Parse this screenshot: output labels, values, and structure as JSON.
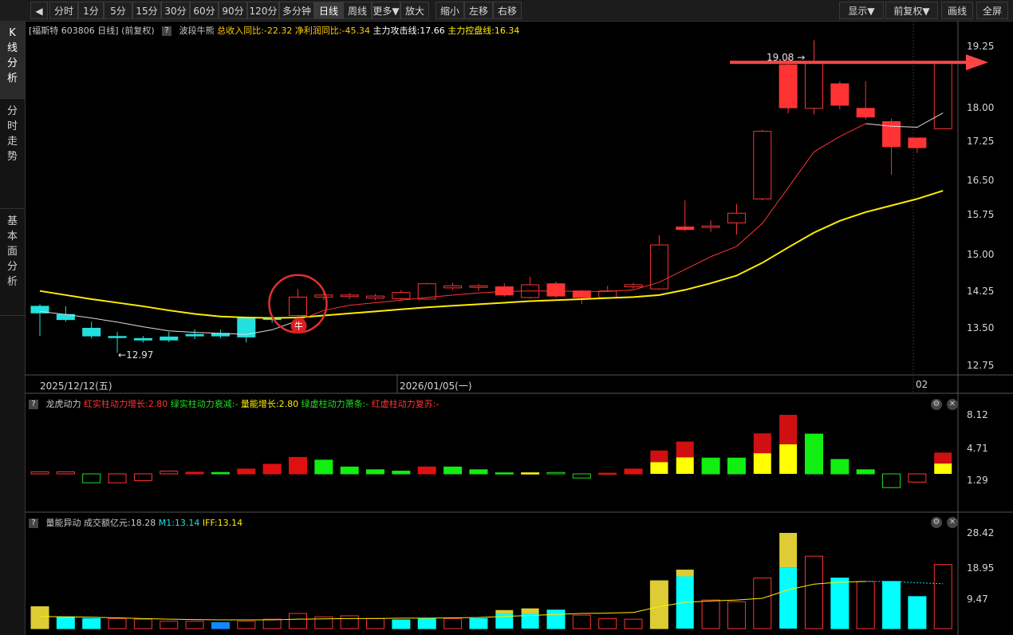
{
  "toolbar": {
    "tabs": [
      "分时",
      "1分",
      "5分",
      "15分",
      "30分",
      "60分",
      "90分",
      "120分",
      "多分钟",
      "日线",
      "周线",
      "更多▼",
      "放大",
      "缩小",
      "左移",
      "右移"
    ],
    "active": "日线",
    "right": [
      "显示▼",
      "前复权▼",
      "画线",
      "全屏"
    ]
  },
  "side_tabs": [
    {
      "label": "K线分析",
      "active": true
    },
    {
      "label": "分时走势",
      "active": false
    },
    {
      "label": "基本面分析",
      "active": false
    }
  ],
  "header": {
    "stock": "[福斯特 603806 日线]",
    "adjust": "(前复权)",
    "help": "?",
    "indicator": "波段牛熊",
    "rev": "总收入同比:-22.32",
    "profit": "净利润同比:-45.34",
    "attack": "主力攻击线:17.66",
    "control": "主力控盘线:16.34"
  },
  "price_axis": [
    "19.25",
    "18.00",
    "17.25",
    "16.50",
    "15.75",
    "15.00",
    "14.25",
    "13.50",
    "12.75"
  ],
  "date_labels": [
    "2025/12/12(五)",
    "2026/01/05(一)",
    "02"
  ],
  "annotations": {
    "high": "19.08",
    "low": "12.97",
    "bull_marker": "牛"
  },
  "panel2": {
    "help": "?",
    "name": "龙虎动力",
    "l1": "红实柱动力增长:2.80",
    "l2": "绿实柱动力衰减:-",
    "l3": "量能增长:2.80",
    "l4": "绿虚柱动力萧条:-",
    "l5": "红虚柱动力复苏:-",
    "axis": [
      "8.12",
      "4.71",
      "1.29"
    ]
  },
  "panel3": {
    "help": "?",
    "name": "量能异动",
    "l1": "成交额亿元:18.28",
    "l2": "M1:13.14",
    "l3": "IFF:13.14",
    "axis": [
      "28.42",
      "18.95",
      "9.47"
    ]
  },
  "colors": {
    "up": "#ff3333",
    "down": "#22e0e0",
    "ma_yellow": "#ffee00",
    "ma_red": "#ff3333",
    "ma_white": "#dddddd",
    "arrow": "#ff4444"
  },
  "chart_data": {
    "type": "candlestick",
    "ylim": [
      12.6,
      19.4
    ],
    "candles": [
      {
        "o": 13.88,
        "c": 13.75,
        "h": 13.92,
        "l": 13.3,
        "up": false
      },
      {
        "o": 13.72,
        "c": 13.62,
        "h": 13.88,
        "l": 13.58,
        "up": false
      },
      {
        "o": 13.45,
        "c": 13.3,
        "h": 13.58,
        "l": 13.25,
        "up": false
      },
      {
        "o": 13.29,
        "c": 13.27,
        "h": 13.38,
        "l": 12.97,
        "up": false
      },
      {
        "o": 13.25,
        "c": 13.22,
        "h": 13.3,
        "l": 13.17,
        "up": false
      },
      {
        "o": 13.28,
        "c": 13.22,
        "h": 13.38,
        "l": 13.18,
        "up": false
      },
      {
        "o": 13.33,
        "c": 13.3,
        "h": 13.43,
        "l": 13.24,
        "up": false
      },
      {
        "o": 13.35,
        "c": 13.3,
        "h": 13.42,
        "l": 13.25,
        "up": false
      },
      {
        "o": 13.65,
        "c": 13.28,
        "h": 13.67,
        "l": 13.17,
        "up": false
      },
      {
        "o": 13.65,
        "c": 13.62,
        "h": 13.7,
        "l": 13.56,
        "up": false
      },
      {
        "o": 13.7,
        "c": 14.06,
        "h": 14.22,
        "l": 13.65,
        "up": true
      },
      {
        "o": 14.06,
        "c": 14.1,
        "h": 14.18,
        "l": 14.0,
        "up": true
      },
      {
        "o": 14.07,
        "c": 14.1,
        "h": 14.14,
        "l": 14.02,
        "up": true
      },
      {
        "o": 14.04,
        "c": 14.08,
        "h": 14.12,
        "l": 14.0,
        "up": true
      },
      {
        "o": 14.03,
        "c": 14.15,
        "h": 14.2,
        "l": 14.0,
        "up": true
      },
      {
        "o": 14.02,
        "c": 14.32,
        "h": 14.34,
        "l": 14.01,
        "up": true
      },
      {
        "o": 14.24,
        "c": 14.28,
        "h": 14.34,
        "l": 14.2,
        "up": true
      },
      {
        "o": 14.25,
        "c": 14.28,
        "h": 14.32,
        "l": 14.18,
        "up": true
      },
      {
        "o": 14.26,
        "c": 14.1,
        "h": 14.33,
        "l": 14.07,
        "up": true
      },
      {
        "o": 14.05,
        "c": 14.3,
        "h": 14.46,
        "l": 14.03,
        "up": true
      },
      {
        "o": 14.32,
        "c": 14.08,
        "h": 14.36,
        "l": 14.04,
        "up": true
      },
      {
        "o": 14.18,
        "c": 14.05,
        "h": 14.2,
        "l": 13.92,
        "up": true
      },
      {
        "o": 14.05,
        "c": 14.18,
        "h": 14.28,
        "l": 14.03,
        "up": true
      },
      {
        "o": 14.26,
        "c": 14.3,
        "h": 14.34,
        "l": 14.22,
        "up": true
      },
      {
        "o": 14.22,
        "c": 15.08,
        "h": 15.27,
        "l": 14.2,
        "up": true
      },
      {
        "o": 15.43,
        "c": 15.38,
        "h": 15.95,
        "l": 15.35,
        "up": true
      },
      {
        "o": 15.42,
        "c": 15.45,
        "h": 15.56,
        "l": 15.33,
        "up": true
      },
      {
        "o": 15.51,
        "c": 15.7,
        "h": 15.88,
        "l": 15.28,
        "up": true
      },
      {
        "o": 15.98,
        "c": 17.3,
        "h": 17.33,
        "l": 15.95,
        "up": true
      },
      {
        "o": 18.6,
        "c": 17.76,
        "h": 18.76,
        "l": 17.65,
        "up": true
      },
      {
        "o": 17.75,
        "c": 18.66,
        "h": 19.08,
        "l": 17.63,
        "up": true
      },
      {
        "o": 18.23,
        "c": 17.81,
        "h": 18.28,
        "l": 17.73,
        "up": true
      },
      {
        "o": 17.75,
        "c": 17.58,
        "h": 18.28,
        "l": 17.53,
        "up": true
      },
      {
        "o": 17.49,
        "c": 17.0,
        "h": 17.55,
        "l": 16.45,
        "up": true
      },
      {
        "o": 17.17,
        "c": 16.98,
        "h": 17.17,
        "l": 16.88,
        "up": true
      },
      {
        "o": 17.35,
        "c": 18.63,
        "h": 18.63,
        "l": 17.35,
        "up": true
      }
    ],
    "ma_white": [
      13.78,
      13.72,
      13.65,
      13.57,
      13.48,
      13.4,
      13.37,
      13.35,
      13.33,
      13.42,
      13.6,
      13.8,
      13.9,
      13.95,
      14.0,
      14.05,
      14.1,
      14.14,
      14.17,
      14.18,
      14.18,
      14.17,
      14.17,
      14.2,
      14.35,
      14.6,
      14.85,
      15.05,
      15.5,
      16.2,
      16.9,
      17.2,
      17.45,
      17.4,
      17.38,
      17.66
    ],
    "ma_yellow": [
      14.18,
      14.1,
      14.02,
      13.95,
      13.88,
      13.8,
      13.73,
      13.68,
      13.66,
      13.65,
      13.66,
      13.7,
      13.74,
      13.78,
      13.82,
      13.86,
      13.89,
      13.92,
      13.95,
      13.98,
      14.0,
      14.02,
      14.04,
      14.06,
      14.1,
      14.2,
      14.33,
      14.48,
      14.73,
      15.03,
      15.32,
      15.55,
      15.72,
      15.85,
      15.98,
      16.14
    ],
    "panel2_values": [
      {
        "v": 0.3,
        "t": "hollow_red"
      },
      {
        "v": 0.3,
        "t": "hollow_red"
      },
      {
        "v": -1.3,
        "t": "hollow_green"
      },
      {
        "v": -1.3,
        "t": "hollow_red"
      },
      {
        "v": -1.0,
        "t": "hollow_red"
      },
      {
        "v": 0.4,
        "t": "hollow_red"
      },
      {
        "v": 0.25,
        "t": "solid_red"
      },
      {
        "v": 0.2,
        "t": "solid_green"
      },
      {
        "v": 0.7,
        "t": "solid_red"
      },
      {
        "v": 1.4,
        "t": "solid_red"
      },
      {
        "v": 2.4,
        "t": "solid_red"
      },
      {
        "v": 2.0,
        "t": "solid_green"
      },
      {
        "v": 1.0,
        "t": "solid_green"
      },
      {
        "v": 0.6,
        "t": "solid_green"
      },
      {
        "v": 0.4,
        "t": "solid_green"
      },
      {
        "v": 1.0,
        "t": "solid_red"
      },
      {
        "v": 1.0,
        "t": "solid_green"
      },
      {
        "v": 0.6,
        "t": "solid_green"
      },
      {
        "v": 0.15,
        "t": "solid_green"
      },
      {
        "v": 0.15,
        "t": "solid_yellow"
      },
      {
        "v": 0.2,
        "t": "hollow_green"
      },
      {
        "v": -0.6,
        "t": "hollow_green"
      },
      {
        "v": 0.1,
        "t": "solid_red"
      },
      {
        "v": 0.7,
        "t": "solid_red"
      },
      {
        "v": 3.4,
        "t": "stack",
        "y": 1.7
      },
      {
        "v": 4.7,
        "t": "stack",
        "y": 2.4
      },
      {
        "v": 2.3,
        "t": "solid_green"
      },
      {
        "v": 2.3,
        "t": "solid_green"
      },
      {
        "v": 5.9,
        "t": "stack",
        "y": 3.0
      },
      {
        "v": 8.6,
        "t": "stack",
        "y": 4.3
      },
      {
        "v": 5.8,
        "t": "solid_green"
      },
      {
        "v": 2.1,
        "t": "solid_green"
      },
      {
        "v": 0.6,
        "t": "solid_green"
      },
      {
        "v": -2.0,
        "t": "hollow_green"
      },
      {
        "v": -1.2,
        "t": "hollow_red"
      },
      {
        "v": 3.1,
        "t": "stack",
        "y": 1.5
      }
    ],
    "panel3_values": [
      {
        "v": 6.5,
        "t": "yellow"
      },
      {
        "v": 3.5,
        "t": "cyan"
      },
      {
        "v": 3.0,
        "t": "cyan"
      },
      {
        "v": 3.0,
        "t": "hollow_red"
      },
      {
        "v": 2.8,
        "t": "hollow_red"
      },
      {
        "v": 2.2,
        "t": "hollow_red"
      },
      {
        "v": 2.2,
        "t": "hollow_red"
      },
      {
        "v": 1.8,
        "t": "blue"
      },
      {
        "v": 2.2,
        "t": "hollow_red"
      },
      {
        "v": 2.8,
        "t": "hollow_red"
      },
      {
        "v": 4.5,
        "t": "hollow_red"
      },
      {
        "v": 3.5,
        "t": "hollow_red"
      },
      {
        "v": 3.8,
        "t": "hollow_red"
      },
      {
        "v": 3.0,
        "t": "hollow_red"
      },
      {
        "v": 2.6,
        "t": "cyan"
      },
      {
        "v": 3.0,
        "t": "cyan"
      },
      {
        "v": 3.0,
        "t": "hollow_red"
      },
      {
        "v": 3.0,
        "t": "cyan"
      },
      {
        "v": 5.5,
        "t": "cyan_yellow",
        "y": 4.5
      },
      {
        "v": 6.0,
        "t": "cyan_yellow",
        "y": 4.5
      },
      {
        "v": 5.5,
        "t": "cyan"
      },
      {
        "v": 4.0,
        "t": "hollow_red"
      },
      {
        "v": 3.0,
        "t": "hollow_red"
      },
      {
        "v": 2.8,
        "t": "hollow_red"
      },
      {
        "v": 14.2,
        "t": "yellow_only"
      },
      {
        "v": 17.5,
        "t": "cyan_yellow",
        "y": 15.5
      },
      {
        "v": 8.5,
        "t": "hollow_red"
      },
      {
        "v": 8.0,
        "t": "hollow_red"
      },
      {
        "v": 15.0,
        "t": "hollow_red"
      },
      {
        "v": 28.4,
        "t": "cyan_yellow",
        "y": 18.2
      },
      {
        "v": 21.5,
        "t": "hollow_red"
      },
      {
        "v": 15.0,
        "t": "cyan"
      },
      {
        "v": 14.0,
        "t": "hollow_red"
      },
      {
        "v": 14.0,
        "t": "cyan"
      },
      {
        "v": 9.5,
        "t": "cyan"
      },
      {
        "v": 19.0,
        "t": "hollow_red"
      }
    ],
    "panel3_ma": [
      3.6,
      3.5,
      3.4,
      3.2,
      3.0,
      2.8,
      2.7,
      2.6,
      2.6,
      2.6,
      2.8,
      2.9,
      3.0,
      3.0,
      3.1,
      3.1,
      3.2,
      3.3,
      3.6,
      3.9,
      4.2,
      4.5,
      4.6,
      4.8,
      6.5,
      7.8,
      8.2,
      8.5,
      9.0,
      11.5,
      13.2,
      13.8,
      14.0,
      14.0,
      13.6,
      13.3
    ]
  }
}
